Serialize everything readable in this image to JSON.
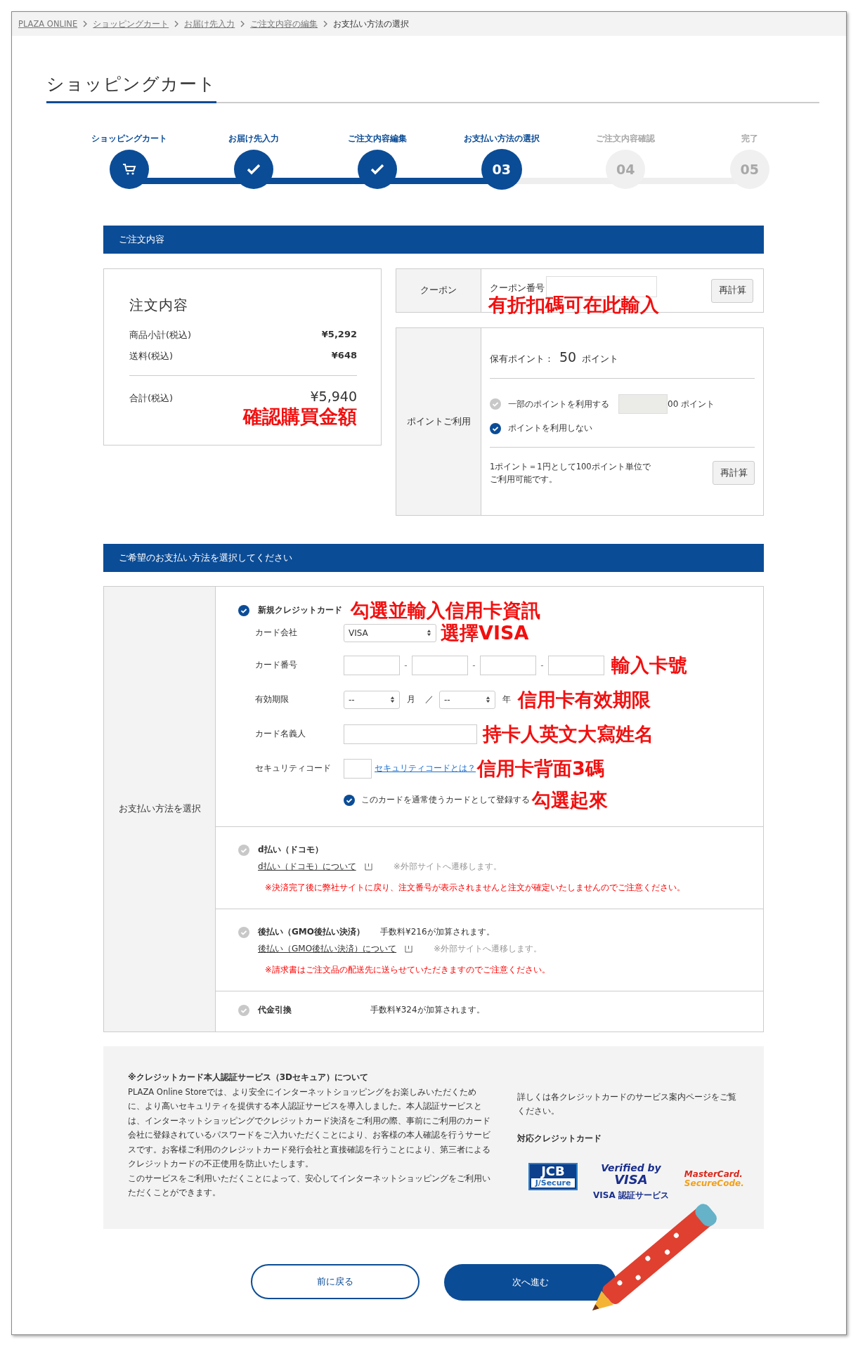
{
  "breadcrumb": [
    {
      "label": "PLAZA ONLINE",
      "link": true
    },
    {
      "label": "ショッピングカート",
      "link": true
    },
    {
      "label": "お届け先入力",
      "link": true
    },
    {
      "label": "ご注文内容の編集",
      "link": true
    },
    {
      "label": "お支払い方法の選択",
      "link": false
    }
  ],
  "page_title": "ショッピングカート",
  "steps": [
    {
      "label": "ショッピングカート",
      "kind": "cart",
      "reached": true,
      "selected": false
    },
    {
      "label": "お届け先入力",
      "kind": "check",
      "reached": true,
      "selected": false
    },
    {
      "label": "ご注文内容編集",
      "kind": "check",
      "reached": true,
      "selected": false
    },
    {
      "label": "お支払い方法の選択",
      "kind": "number",
      "number": "03",
      "reached": true,
      "selected": true
    },
    {
      "label": "ご注文内容確認",
      "kind": "number",
      "number": "04",
      "reached": false,
      "selected": false
    },
    {
      "label": "完了",
      "kind": "number",
      "number": "05",
      "reached": false,
      "selected": false
    }
  ],
  "order_header": "ご注文内容",
  "order_summary": {
    "title": "注文内容",
    "lines": [
      {
        "label": "商品小計(税込)",
        "amount": "¥5,292"
      },
      {
        "label": "送料(税込)",
        "amount": "¥648"
      }
    ],
    "total_label": "合計(税込)",
    "total": "¥5,940",
    "annotation": "確認購買金額"
  },
  "coupon": {
    "heading": "クーポン",
    "label": "クーポン番号",
    "button": "再計算",
    "annotation": "有折扣碼可在此輸入"
  },
  "points": {
    "heading": "ポイントご利用",
    "held_label": "保有ポイント：",
    "held_value": "50",
    "held_unit": "ポイント",
    "options": [
      {
        "label": "一部のポイントを利用する",
        "selected": false,
        "suffix": "00 ポイント"
      },
      {
        "label": "ポイントを利用しない",
        "selected": true
      }
    ],
    "note_lines": [
      "1ポイント＝1円として100ポイント単位で",
      "ご利用可能です。"
    ],
    "button": "再計算"
  },
  "payment_header": "ご希望のお支払い方法を選択してください",
  "payment_side_label": "お支払い方法を選択",
  "payment_methods": [
    {
      "kind": "card",
      "name": "新規クレジットカード",
      "selected": true,
      "annotation": "勾選並輸入信用卡資訊",
      "card_form": {
        "company_label": "カード会社",
        "company_value": "VISA",
        "company_annotation": "選擇VISA",
        "number_label": "カード番号",
        "number_separator": "-",
        "number_annotation": "輸入卡號",
        "expiry_label": "有効期限",
        "month_value": "--",
        "month_unit": "月",
        "expiry_slash": "／",
        "year_value": "--",
        "year_unit": "年",
        "expiry_annotation": "信用卡有效期限",
        "holder_label": "カード名義人",
        "holder_annotation": "持卡人英文大寫姓名",
        "security_label": "セキュリティコード",
        "security_link": "セキュリティコードとは？",
        "security_annotation": "信用卡背面3碼",
        "save_label": "このカードを通常使うカードとして登録する",
        "save_checked": true,
        "save_annotation": "勾選起來"
      }
    },
    {
      "kind": "external",
      "name": "d払い（ドコモ）",
      "selected": false,
      "link": "d払い（ドコモ）について",
      "external_note": "※外部サイトへ遷移します。",
      "warning": "※決済完了後に弊社サイトに戻り、注文番号が表示されませんと注文が確定いたしませんのでご注意ください。"
    },
    {
      "kind": "external",
      "name": "後払い（GMO後払い決済）",
      "selected": false,
      "fee": "手数料¥216が加算されます。",
      "link": "後払い（GMO後払い決済）について",
      "external_note": "※外部サイトへ遷移します。",
      "warning": "※請求書はご注文品の配送先に送らせていただきますのでご注意ください。"
    },
    {
      "kind": "cod",
      "name": "代金引換",
      "selected": false,
      "fee": "手数料¥324が加算されます。"
    }
  ],
  "secure_info": {
    "title": "※クレジットカード本人認証サービス（3Dセキュア）について",
    "paragraphs": [
      "PLAZA Online Storeでは、より安全にインターネットショッピングをお楽しみいただくために、より高いセキュリティを提供する本人認証サービスを導入しました。本人認証サービスとは、インターネットショッピングでクレジットカード決済をご利用の際、事前にご利用のカード会社に登録されているパスワードをご入力いただくことにより、お客様の本人確認を行うサービスです。お客様ご利用のクレジットカード発行会社と直接確認を行うことにより、第三者によるクレジットカードの不正使用を防止いたします。",
      "このサービスをご利用いただくことによって、安心してインターネットショッピングをご利用いただくことができます。"
    ],
    "side_note": "詳しくは各クレジットカードのサービス案内ページをご覧ください。",
    "cards_title": "対応クレジットカード",
    "logos": [
      {
        "kind": "jcb",
        "lines": [
          "JCB",
          "J/Secure"
        ]
      },
      {
        "kind": "visa",
        "lines": [
          "Verified by",
          "VISA",
          "VISA 認証サービス"
        ]
      },
      {
        "kind": "mastercard",
        "lines": [
          "MasterCard.",
          "SecureCode."
        ]
      }
    ]
  },
  "buttons": {
    "back": "前に戻る",
    "next": "次へ進む"
  }
}
